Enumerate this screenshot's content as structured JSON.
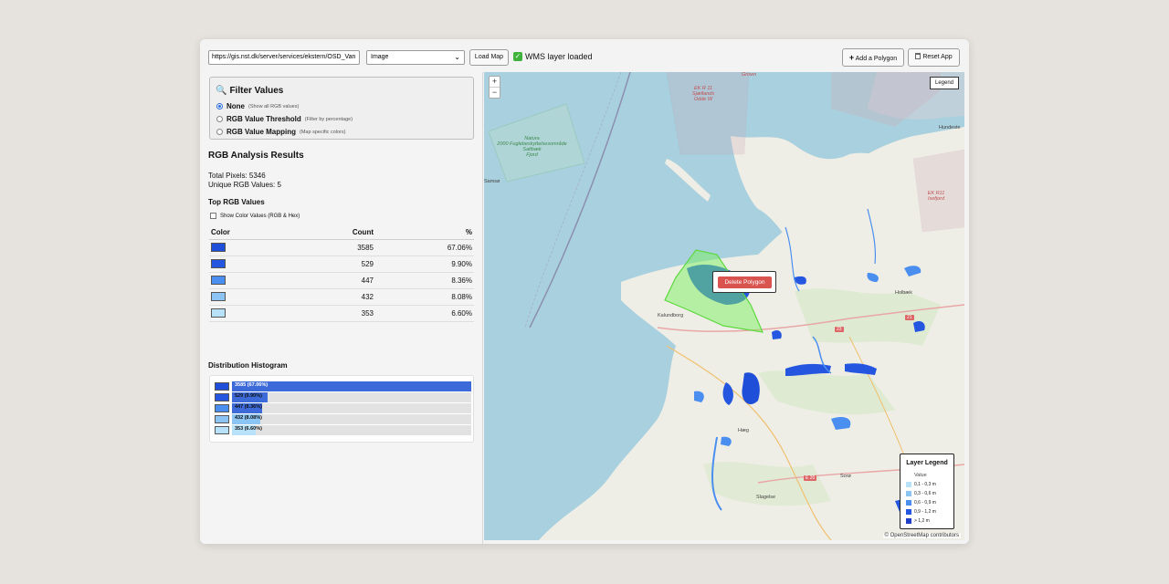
{
  "toolbar": {
    "url_value": "https://gis.nst.dk/server/services/ekstern/OSD_Van",
    "layer_select_value": "Image",
    "load_button": "Load Map",
    "status_text": "WMS layer loaded",
    "add_polygon_button": "Add a Polygon",
    "reset_button": "Reset App"
  },
  "filter": {
    "title": "Filter Values",
    "options": [
      {
        "label": "None",
        "hint": "(Show all RGB values)",
        "selected": true
      },
      {
        "label": "RGB Value Threshold",
        "hint": "(Filter by percentage)",
        "selected": false
      },
      {
        "label": "RGB Value Mapping",
        "hint": "(Map specific colors)",
        "selected": false
      }
    ]
  },
  "results": {
    "title": "RGB Analysis Results",
    "total_pixels": "Total Pixels: 5346",
    "unique_values": "Unique RGB Values: 5",
    "top_title": "Top RGB Values",
    "show_color_values": "Show Color Values (RGB & Hex)",
    "columns": {
      "color": "Color",
      "count": "Count",
      "pct": "%"
    },
    "rows": [
      {
        "color": "#1f4fd8",
        "count": "3585",
        "pct": "67.06%"
      },
      {
        "color": "#2456e0",
        "count": "529",
        "pct": "9.90%"
      },
      {
        "color": "#4a8ff0",
        "count": "447",
        "pct": "8.36%"
      },
      {
        "color": "#8cc4f4",
        "count": "432",
        "pct": "8.08%"
      },
      {
        "color": "#b8e2fa",
        "count": "353",
        "pct": "6.60%"
      }
    ]
  },
  "histogram": {
    "title": "Distribution Histogram",
    "bars": [
      {
        "label": "3585 (67.06%)",
        "fraction": 1.0,
        "color": "#1f4fd8"
      },
      {
        "label": "529 (9.90%)",
        "fraction": 0.148,
        "color": "#2456e0"
      },
      {
        "label": "447 (8.36%)",
        "fraction": 0.125,
        "color": "#4a8ff0"
      },
      {
        "label": "432 (8.08%)",
        "fraction": 0.12,
        "color": "#8cc4f4"
      },
      {
        "label": "353 (6.60%)",
        "fraction": 0.098,
        "color": "#b8e2fa"
      }
    ]
  },
  "map": {
    "zoom_in": "+",
    "zoom_out": "−",
    "legend_button": "Legend",
    "delete_polygon": "Delete Polygon",
    "attribution": "© OpenStreetMap contributors",
    "labels": {
      "natura": "Natura\n2000 Fuglebeskyttelsesområde\nSaltbæk\nFjord",
      "ek11": "EK R 11\nSjællands\nOdde W",
      "ek11b": "EK R11\nIsefjord",
      "kalundborg": "Kalundborg",
      "holbaek": "Holbæk",
      "haeg": "Hæg",
      "slagelse": "Slagelse",
      "soro": "Sorø",
      "e20": "E 20",
      "r21": "21",
      "r23": "23",
      "samsø": "Samsø",
      "grisen": "Grisen",
      "hundested": "Hundeste"
    },
    "layer_legend": {
      "title": "Layer Legend",
      "subtitle": "Value",
      "items": [
        {
          "label": "0,1 - 0,3 m",
          "color": "#b8e2fa"
        },
        {
          "label": "0,3 - 0,6 m",
          "color": "#8cc4f4"
        },
        {
          "label": "0,6 - 0,9 m",
          "color": "#4a8ff0"
        },
        {
          "label": "0,9 - 1,2 m",
          "color": "#2456e0"
        },
        {
          "label": "> 1,2 m",
          "color": "#1f3fc8"
        }
      ]
    }
  },
  "icons": {
    "search": "magnifier-icon",
    "add": "plus-icon",
    "reset": "trash-icon",
    "check": "check-icon"
  }
}
